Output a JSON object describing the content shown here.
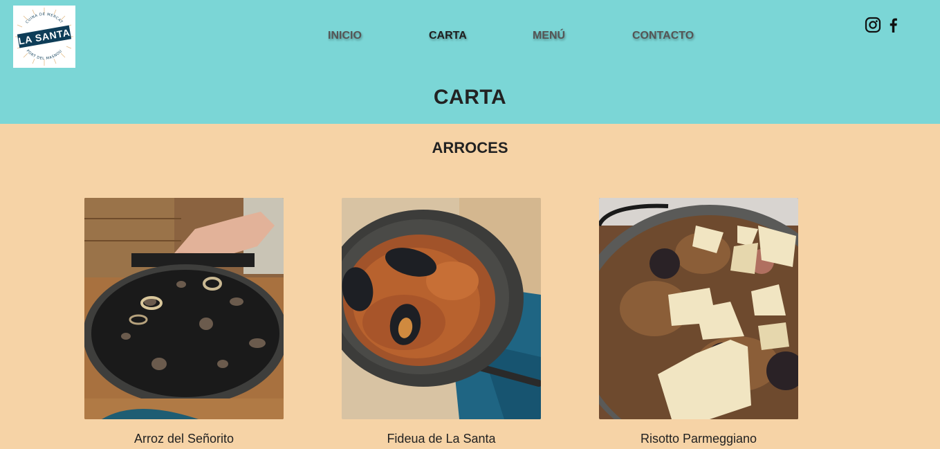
{
  "brand": {
    "name": "LA SANTA",
    "ring_top": "CUINA DE MERCAT",
    "ring_bottom": "PORT DEL MASNOU",
    "accent": "#0e3d58"
  },
  "nav": {
    "items": [
      {
        "label": "INICIO",
        "active": false
      },
      {
        "label": "CARTA",
        "active": true
      },
      {
        "label": "MENÚ",
        "active": false
      },
      {
        "label": "CONTACTO",
        "active": false
      }
    ]
  },
  "social": {
    "icons": [
      "instagram-icon",
      "facebook-icon"
    ]
  },
  "page": {
    "title": "CARTA"
  },
  "section": {
    "title": "ARROCES",
    "dishes": [
      {
        "name": "Arroz del Señorito",
        "image": "black-rice-paella-photo"
      },
      {
        "name": "Fideua de La Santa",
        "image": "fideua-mussels-photo"
      },
      {
        "name": "Risotto Parmeggiano",
        "image": "risotto-parmesan-photo"
      }
    ]
  },
  "colors": {
    "header_bg": "#7bd6d6",
    "body_bg": "#f6d3a6",
    "nav_text": "#555555",
    "nav_active": "#1e1e1e"
  }
}
